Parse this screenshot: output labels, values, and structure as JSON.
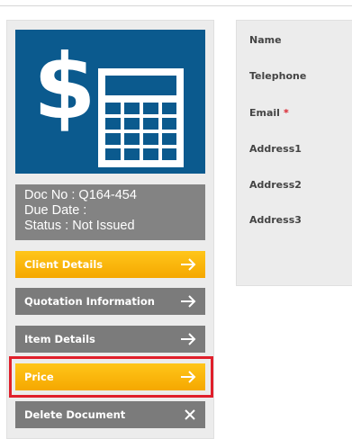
{
  "doc_info": {
    "doc_no": "Doc No : Q164-454",
    "due_date": "Due Date :",
    "status": "Status : Not Issued"
  },
  "nav": {
    "client_details": "Client Details",
    "quotation_information": "Quotation Information",
    "item_details": "Item Details",
    "price": "Price",
    "delete_document": "Delete Document"
  },
  "form": {
    "name_label": "Name",
    "telephone_label": "Telephone",
    "email_label": "Email",
    "required_marker": "*",
    "address1_label": "Address1",
    "address2_label": "Address2",
    "address3_label": "Address3"
  },
  "colors": {
    "logo_background": "#0b5a8e",
    "button_yellow": "#f5a800",
    "button_gray": "#7b7b7b",
    "highlight": "#e01f2b"
  }
}
